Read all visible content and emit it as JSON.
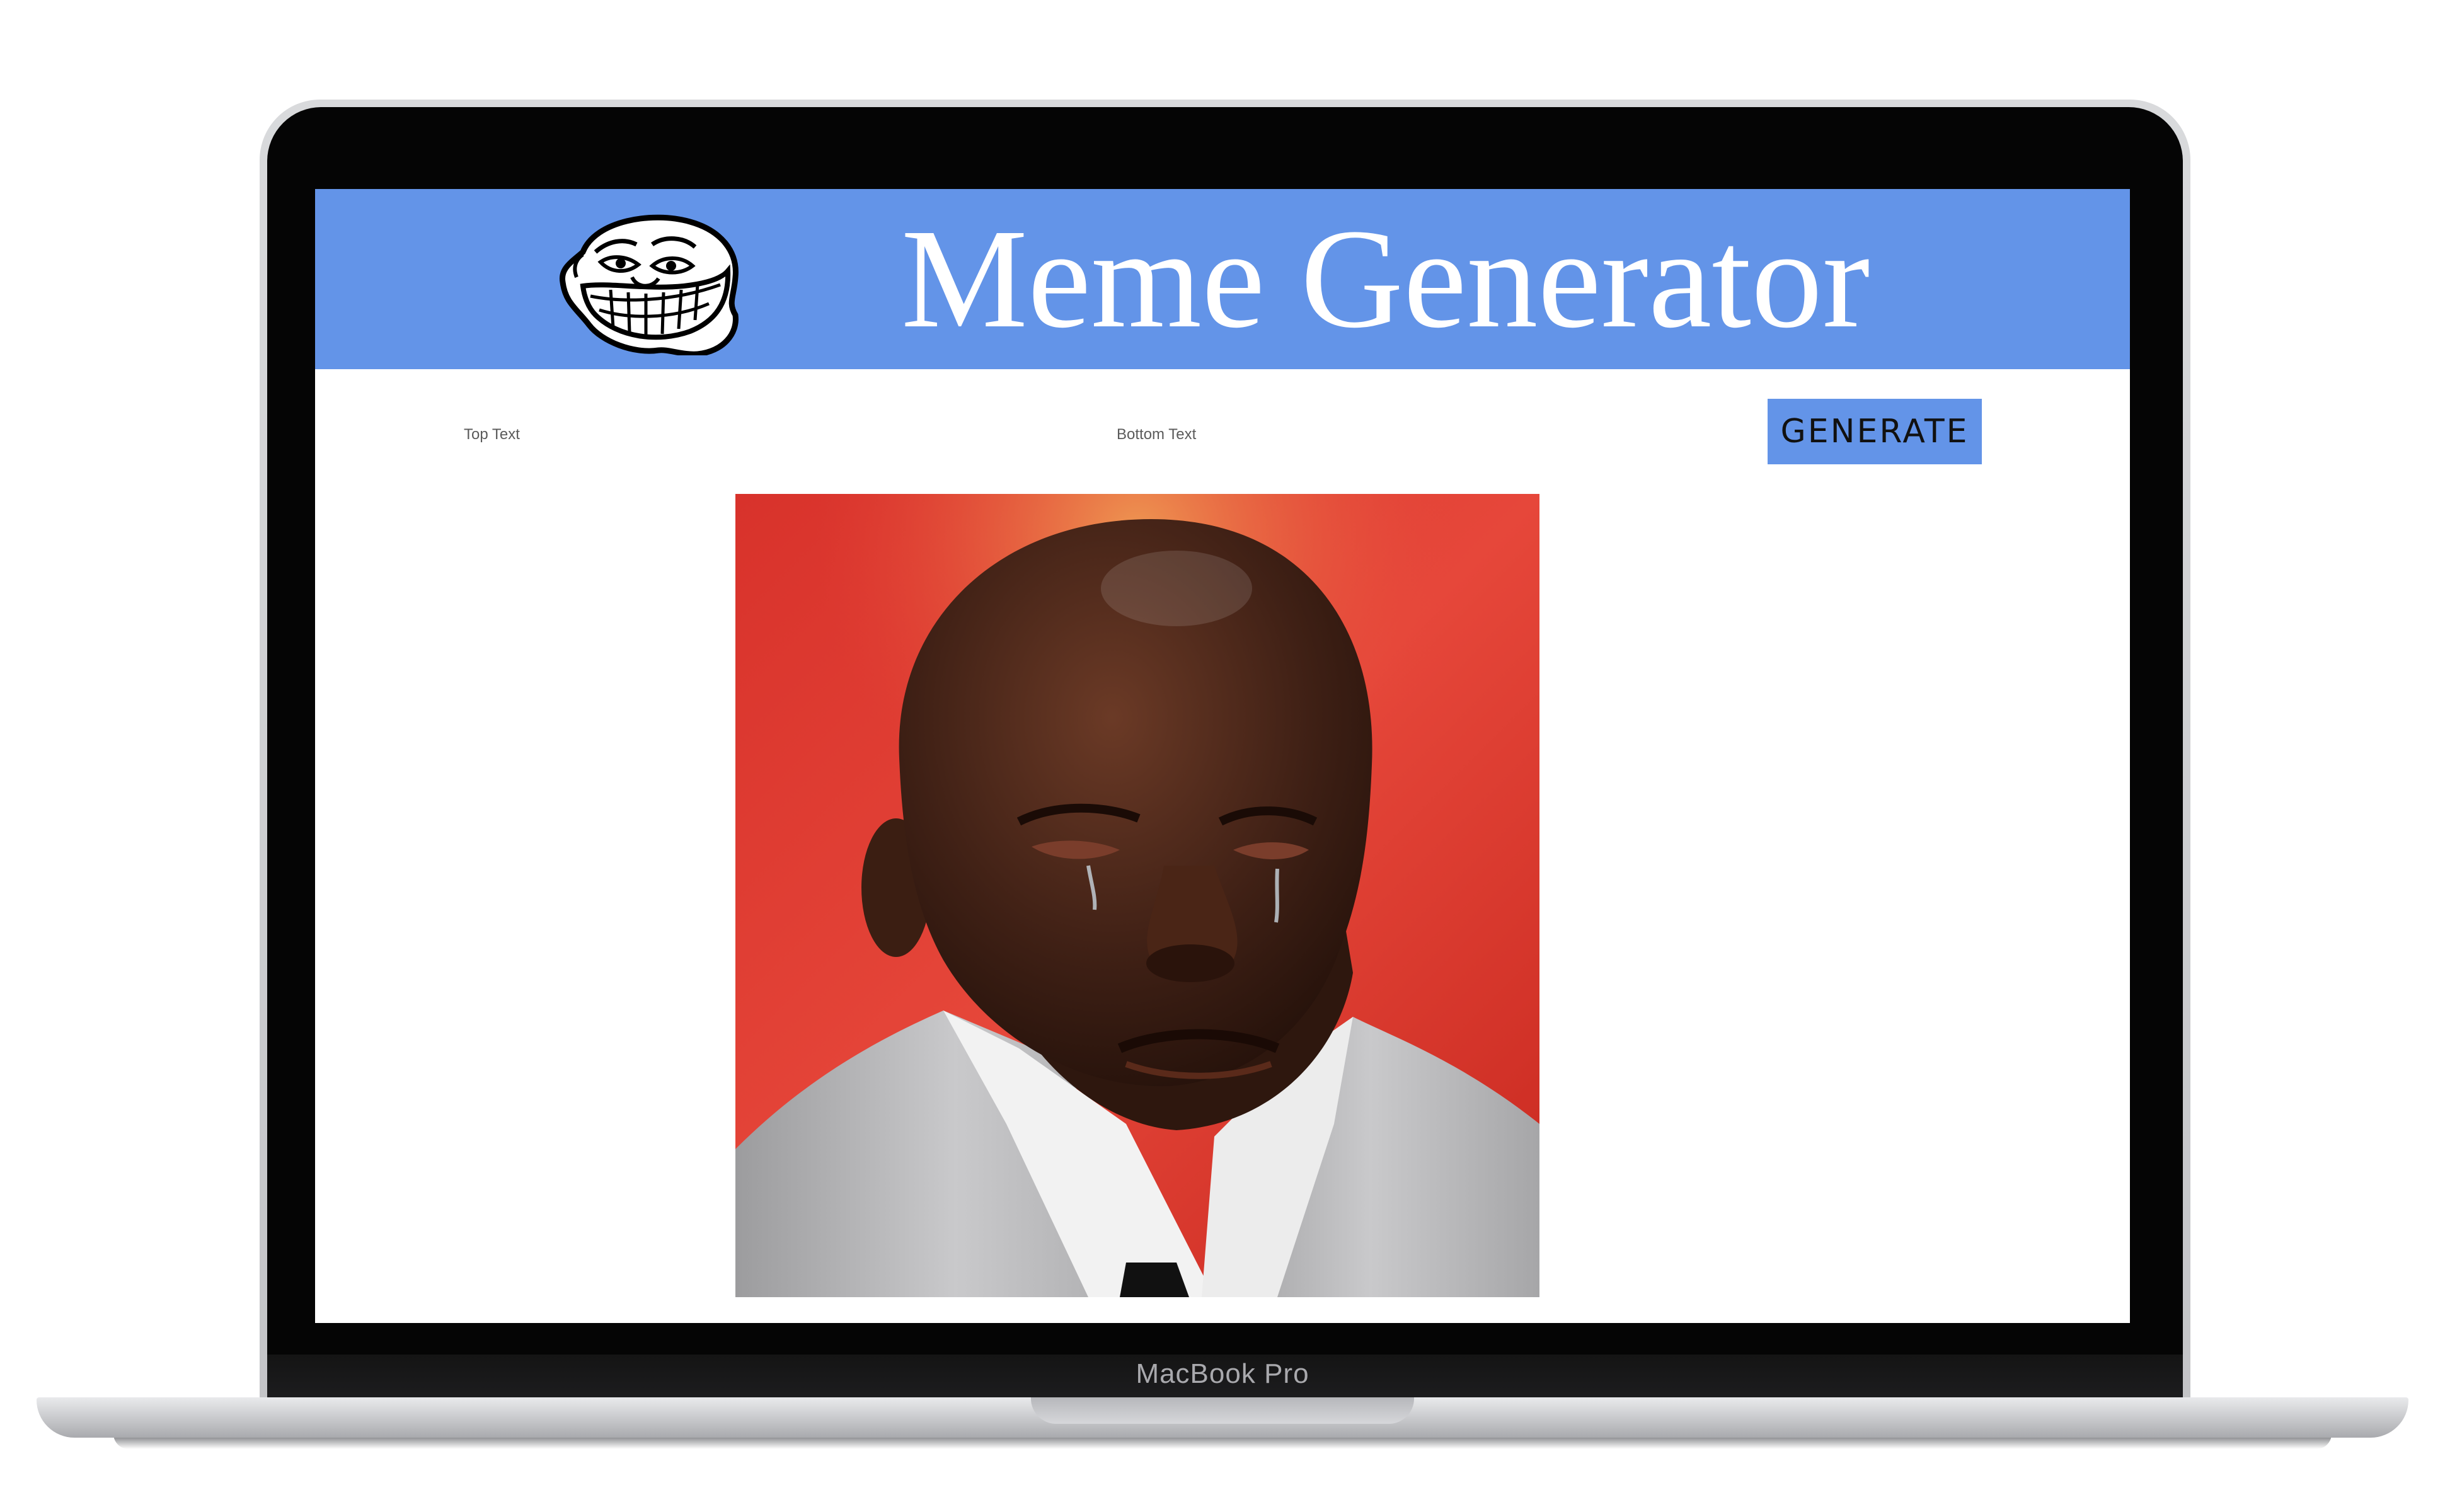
{
  "device": {
    "label": "MacBook Pro"
  },
  "header": {
    "title": "Meme Generator",
    "logo_icon": "troll-face-icon",
    "background_color": "#6394e8"
  },
  "form": {
    "top_text_placeholder": "Top Text",
    "top_text_value": "",
    "bottom_text_placeholder": "Bottom Text",
    "bottom_text_value": "",
    "generate_label": "GENERATE"
  },
  "meme": {
    "image": "crying-jordan-meme-image"
  }
}
